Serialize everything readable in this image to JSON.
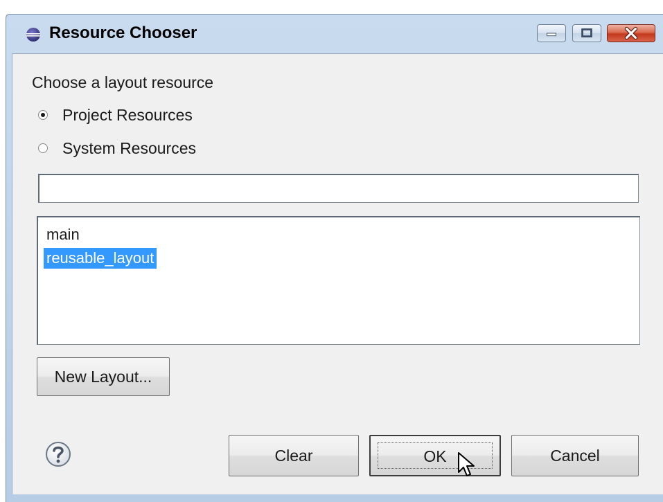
{
  "window": {
    "title": "Resource Chooser",
    "controls": {
      "minimize_icon": "minimize-icon",
      "maximize_icon": "maximize-icon",
      "close_icon": "close-icon"
    },
    "app_icon": "eclipse-icon"
  },
  "chooser": {
    "prompt": "Choose a layout resource",
    "options": [
      {
        "label": "Project Resources",
        "selected": true
      },
      {
        "label": "System Resources",
        "selected": false
      }
    ],
    "filter": {
      "value": "",
      "placeholder": ""
    },
    "items": [
      {
        "label": "main",
        "selected": false
      },
      {
        "label": "reusable_layout",
        "selected": true
      }
    ],
    "new_layout_label": "New Layout..."
  },
  "footer": {
    "help_icon": "help-icon",
    "clear_label": "Clear",
    "ok_label": "OK",
    "cancel_label": "Cancel"
  },
  "colors": {
    "selection": "#3399ff",
    "titlebar": "#c9dbee",
    "close_button": "#c4391d"
  }
}
